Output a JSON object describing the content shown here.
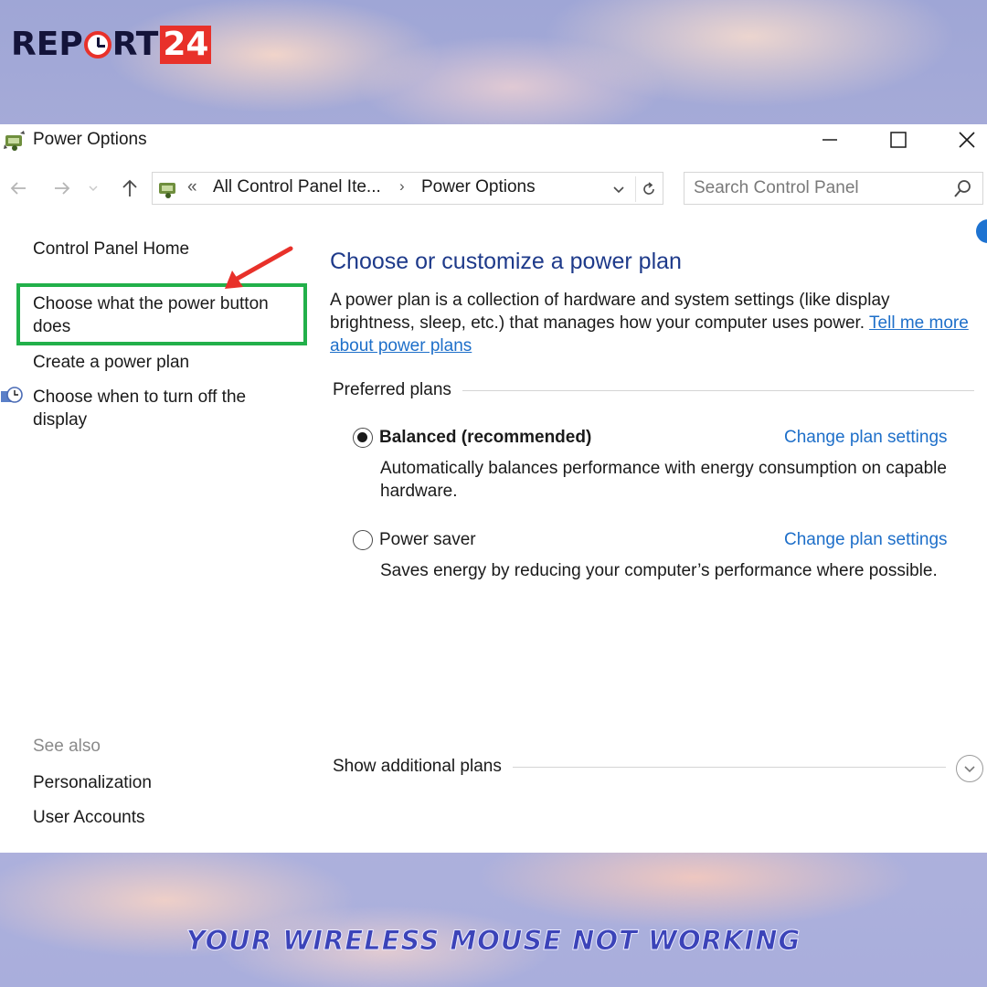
{
  "logo": {
    "part_a": "REP",
    "part_mid": "RT",
    "part_b": "24"
  },
  "window": {
    "title": "Power Options",
    "icons": {
      "app": "power-options-icon",
      "minimize": "minimize-icon",
      "maximize": "maximize-icon",
      "close": "close-icon"
    }
  },
  "navbar": {
    "overflow_marker": "«",
    "crumbs": [
      "All Control Panel Ite...",
      "Power Options"
    ],
    "crumb_separator": "›",
    "search_placeholder": "Search Control Panel"
  },
  "left_pane": {
    "home": "Control Panel Home",
    "power_button": "Choose what the power button does",
    "create_plan": "Create a power plan",
    "turn_off_display": "Choose when to turn off the display",
    "see_also": "See also",
    "personalization": "Personalization",
    "user_accounts": "User Accounts"
  },
  "main": {
    "heading": "Choose or customize a power plan",
    "description": "A power plan is a collection of hardware and system settings (like display brightness, sleep, etc.) that manages how your computer uses power. ",
    "description_link": "Tell me more about power plans",
    "preferred_plans": "Preferred plans",
    "plans": [
      {
        "name": "Balanced (recommended)",
        "selected": true,
        "settings_link": "Change plan settings",
        "description": "Automatically balances performance with energy consumption on capable hardware."
      },
      {
        "name": "Power saver",
        "selected": false,
        "settings_link": "Change plan settings",
        "description": "Saves energy by reducing your computer’s performance where possible."
      }
    ],
    "show_additional": "Show additional plans"
  },
  "caption": "YOUR WIRELESS MOUSE NOT WORKING",
  "colors": {
    "highlight": "#22b04a",
    "arrow": "#e8312a",
    "link": "#1e6fc9",
    "heading": "#1e3a8a"
  }
}
